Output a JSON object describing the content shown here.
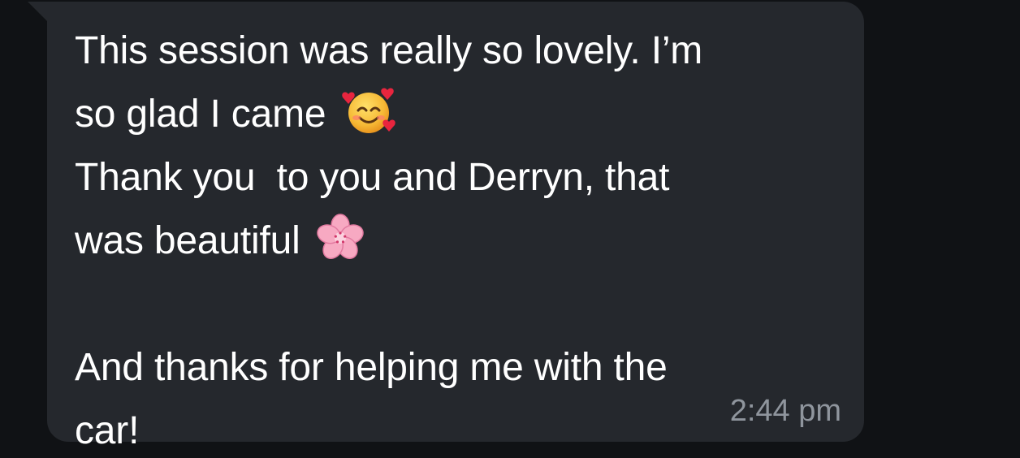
{
  "message": {
    "line1": "This session was really so lovely. I’m",
    "line2": "so glad I came",
    "line3": "Thank you  to you and Derryn, that",
    "line4": "was beautiful",
    "line5": "And thanks for helping me with the",
    "line6": "car!",
    "time": "2:44 pm",
    "emoji_1": "smiling-face-with-hearts",
    "emoji_2": "cherry-blossom"
  },
  "colors": {
    "background": "#101215",
    "bubble": "#25282d",
    "text": "#ffffff",
    "timestamp": "#8f959d"
  }
}
